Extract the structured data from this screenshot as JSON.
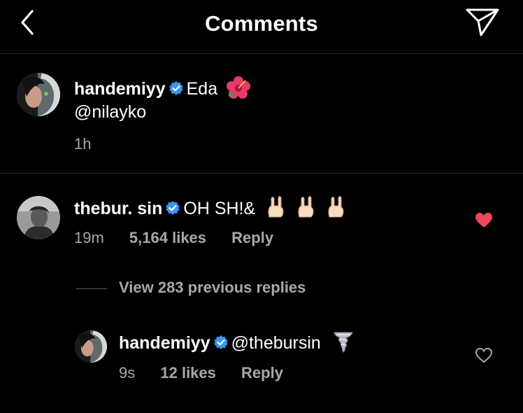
{
  "header": {
    "title": "Comments",
    "back_icon": "chevron-left-icon",
    "send_icon": "paper-plane-icon"
  },
  "caption": {
    "username": "handemiyy",
    "verified": true,
    "text": "Eda",
    "emoji": "hibiscus",
    "mention": "@nilayko",
    "time": "1h"
  },
  "comment": {
    "username": "thebur. sin",
    "verified": true,
    "text": "OH SH!&",
    "emoji": "sign-of-the-horns x3",
    "time": "19m",
    "likes": "5,164 likes",
    "reply_label": "Reply",
    "liked": true,
    "heart_color": "#ed4956"
  },
  "view_replies": "View 283 previous replies",
  "reply": {
    "username": "handemiyy",
    "verified": true,
    "text": "@thebursin",
    "emoji": "tornado",
    "time": "9s",
    "likes": "12 likes",
    "reply_label": "Reply",
    "liked": false
  },
  "colors": {
    "background": "#000000",
    "text": "#ffffff",
    "secondary_text": "#a8a8a8",
    "verified_badge": "#3897f0",
    "divider": "#262626"
  }
}
